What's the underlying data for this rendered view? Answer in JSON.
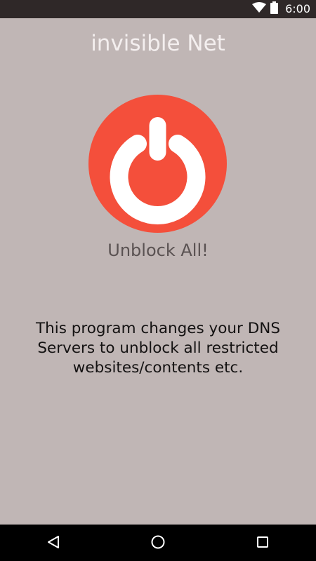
{
  "status_bar": {
    "time": "6:00",
    "icons": [
      "wifi-icon",
      "battery-icon"
    ]
  },
  "app": {
    "title": "invisible Net",
    "action_label": "Unblock All!",
    "description": "This program changes your DNS Servers to unblock all restricted websites/contents etc."
  },
  "power_button": {
    "icon": "power-icon",
    "color": "#f44f3b"
  },
  "nav_bar": {
    "buttons": [
      "back-icon",
      "home-icon",
      "recents-icon"
    ]
  },
  "colors": {
    "background": "#c0b6b5",
    "status_bar": "#2f2828",
    "nav_bar": "#000000",
    "accent": "#f44f3b"
  }
}
